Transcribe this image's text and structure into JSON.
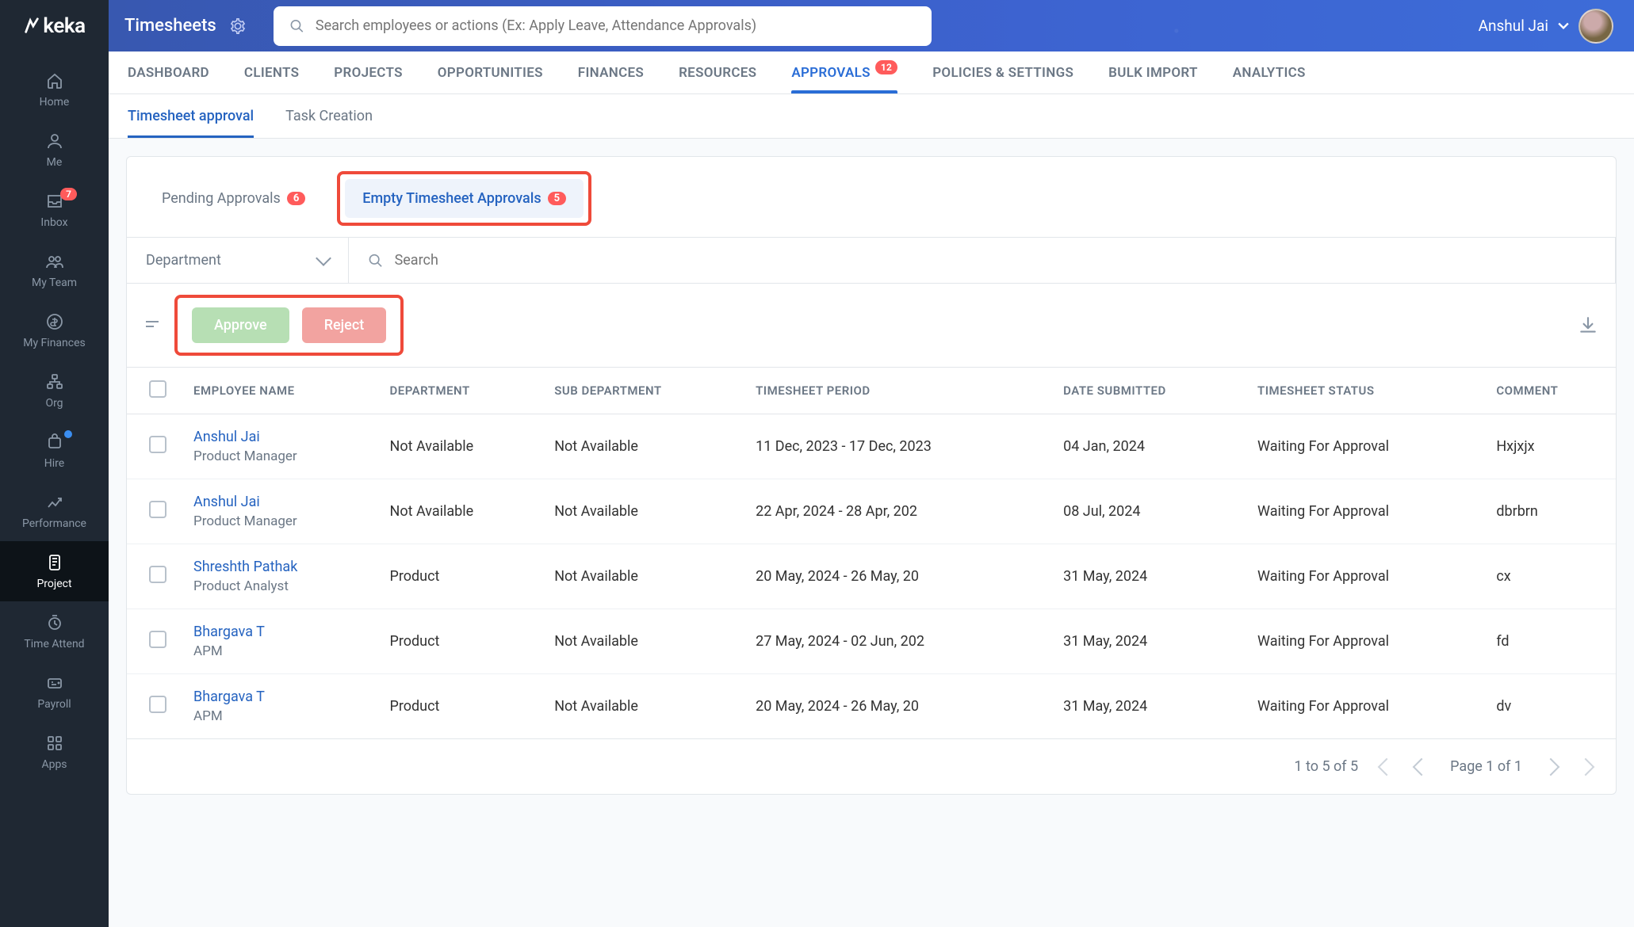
{
  "app": {
    "logo": "keka"
  },
  "sidebar": {
    "items": [
      {
        "label": "Home",
        "icon": "home"
      },
      {
        "label": "Me",
        "icon": "user"
      },
      {
        "label": "Inbox",
        "icon": "inbox",
        "badge": "7"
      },
      {
        "label": "My Team",
        "icon": "team"
      },
      {
        "label": "My Finances",
        "icon": "finances"
      },
      {
        "label": "Org",
        "icon": "org"
      },
      {
        "label": "Hire",
        "icon": "hire",
        "dot": true
      },
      {
        "label": "Performance",
        "icon": "performance"
      },
      {
        "label": "Project",
        "icon": "project",
        "active": true
      },
      {
        "label": "Time Attend",
        "icon": "time"
      },
      {
        "label": "Payroll",
        "icon": "payroll"
      },
      {
        "label": "Apps",
        "icon": "apps"
      }
    ]
  },
  "topbar": {
    "title": "Timesheets",
    "search_placeholder": "Search employees or actions (Ex: Apply Leave, Attendance Approvals)",
    "user_name": "Anshul Jai"
  },
  "primary_tabs": [
    {
      "label": "DASHBOARD"
    },
    {
      "label": "CLIENTS"
    },
    {
      "label": "PROJECTS"
    },
    {
      "label": "OPPORTUNITIES"
    },
    {
      "label": "FINANCES"
    },
    {
      "label": "RESOURCES"
    },
    {
      "label": "APPROVALS",
      "badge": "12",
      "active": true
    },
    {
      "label": "POLICIES & SETTINGS"
    },
    {
      "label": "BULK IMPORT"
    },
    {
      "label": "ANALYTICS"
    }
  ],
  "secondary_tabs": [
    {
      "label": "Timesheet approval",
      "active": true
    },
    {
      "label": "Task Creation"
    }
  ],
  "sub_tabs": [
    {
      "label": "Pending Approvals",
      "badge": "6"
    },
    {
      "label": "Empty Timesheet Approvals",
      "badge": "5",
      "active": true,
      "highlighted": true
    }
  ],
  "filters": {
    "department_label": "Department",
    "search_placeholder": "Search"
  },
  "actions": {
    "approve": "Approve",
    "reject": "Reject"
  },
  "table": {
    "columns": [
      "EMPLOYEE NAME",
      "DEPARTMENT",
      "SUB DEPARTMENT",
      "TIMESHEET PERIOD",
      "DATE SUBMITTED",
      "TIMESHEET STATUS",
      "COMMENT"
    ],
    "rows": [
      {
        "name": "Anshul Jai",
        "role": "Product Manager",
        "dept": "Not Available",
        "subdept": "Not Available",
        "period": "11 Dec, 2023 - 17 Dec, 2023",
        "submitted": "04 Jan, 2024",
        "status": "Waiting For Approval",
        "comment": "Hxjxjx"
      },
      {
        "name": "Anshul Jai",
        "role": "Product Manager",
        "dept": "Not Available",
        "subdept": "Not Available",
        "period": "22 Apr, 2024 - 28 Apr, 202",
        "submitted": "08 Jul, 2024",
        "status": "Waiting For Approval",
        "comment": "dbrbrn"
      },
      {
        "name": "Shreshth Pathak",
        "role": "Product Analyst",
        "dept": "Product",
        "subdept": "Not Available",
        "period": "20 May, 2024 - 26 May, 20",
        "submitted": "31 May, 2024",
        "status": "Waiting For Approval",
        "comment": "cx"
      },
      {
        "name": "Bhargava T",
        "role": "APM",
        "dept": "Product",
        "subdept": "Not Available",
        "period": "27 May, 2024 - 02 Jun, 202",
        "submitted": "31 May, 2024",
        "status": "Waiting For Approval",
        "comment": "fd"
      },
      {
        "name": "Bhargava T",
        "role": "APM",
        "dept": "Product",
        "subdept": "Not Available",
        "period": "20 May, 2024 - 26 May, 20",
        "submitted": "31 May, 2024",
        "status": "Waiting For Approval",
        "comment": "dv"
      }
    ]
  },
  "footer": {
    "range": "1 to 5 of 5",
    "page": "Page 1 of 1"
  }
}
